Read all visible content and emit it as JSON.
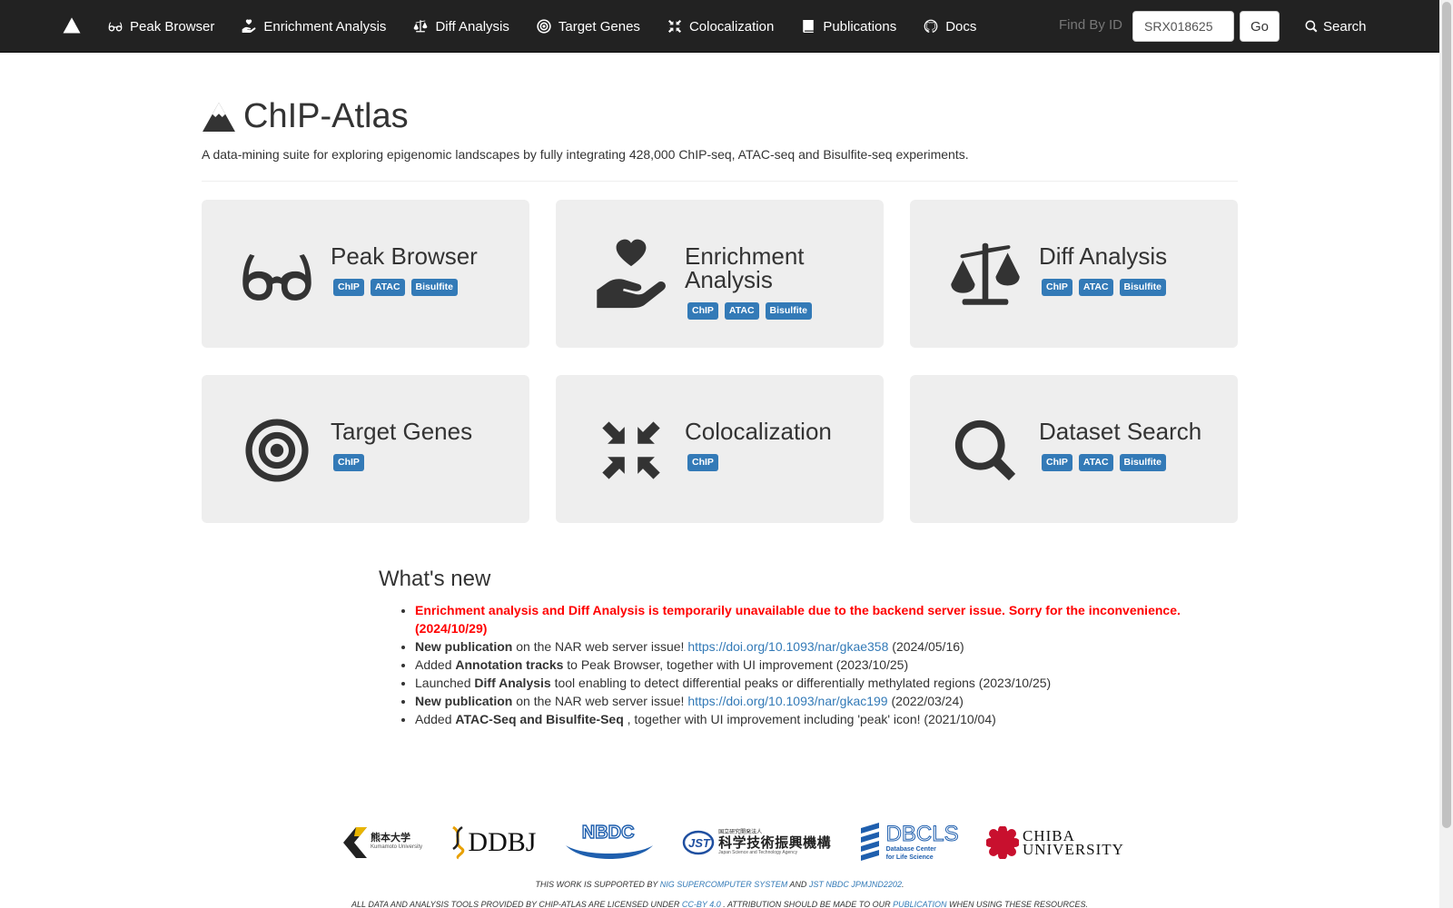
{
  "nav": {
    "brand_icon": "mountain-icon",
    "items": [
      {
        "label": "Peak Browser",
        "icon": "glasses-icon"
      },
      {
        "label": "Enrichment Analysis",
        "icon": "hand-holding-heart-icon"
      },
      {
        "label": "Diff Analysis",
        "icon": "scale-icon"
      },
      {
        "label": "Target Genes",
        "icon": "target-icon"
      },
      {
        "label": "Colocalization",
        "icon": "compress-icon"
      },
      {
        "label": "Publications",
        "icon": "book-icon"
      },
      {
        "label": "Docs",
        "icon": "github-icon"
      }
    ],
    "find_by_id_label": "Find By ID",
    "find_by_id_value": "SRX018625",
    "go_label": "Go",
    "search_label": "Search"
  },
  "header": {
    "title": "ChIP-Atlas",
    "subtitle": "A data-mining suite for exploring epigenomic landscapes by fully integrating 428,000 ChIP-seq, ATAC-seq and Bisulfite-seq experiments."
  },
  "cards": [
    {
      "title": "Peak Browser",
      "icon": "glasses-icon",
      "badges": [
        "ChIP",
        "ATAC",
        "Bisulfite"
      ]
    },
    {
      "title": "Enrichment Analysis",
      "icon": "hand-holding-heart-icon",
      "badges": [
        "ChIP",
        "ATAC",
        "Bisulfite"
      ]
    },
    {
      "title": "Diff Analysis",
      "icon": "scale-icon",
      "badges": [
        "ChIP",
        "ATAC",
        "Bisulfite"
      ]
    },
    {
      "title": "Target Genes",
      "icon": "target-icon",
      "badges": [
        "ChIP"
      ]
    },
    {
      "title": "Colocalization",
      "icon": "compress-icon",
      "badges": [
        "ChIP"
      ]
    },
    {
      "title": "Dataset Search",
      "icon": "search-icon",
      "badges": [
        "ChIP",
        "ATAC",
        "Bisulfite"
      ]
    }
  ],
  "whats_new": {
    "title": "What's new",
    "alert": "Enrichment analysis and Diff Analysis is temporarily unavailable due to the backend server issue. Sorry for the inconvenience. (2024/10/29)",
    "items": [
      {
        "bold": "New publication",
        "text": " on the NAR web server issue! ",
        "link": "https://doi.org/10.1093/nar/gkae358",
        "after": " (2024/05/16)"
      },
      {
        "pre": "Added ",
        "bold": "Annotation tracks",
        "text": " to Peak Browser, together with UI improvement (2023/10/25)"
      },
      {
        "pre": "Launched ",
        "bold": "Diff Analysis",
        "text": " tool enabling to detect differential peaks or differentially methylated regions (2023/10/25)"
      },
      {
        "bold": "New publication",
        "text": " on the NAR web server issue! ",
        "link": "https://doi.org/10.1093/nar/gkac199",
        "after": " (2022/03/24)"
      },
      {
        "pre": "Added ",
        "bold": "ATAC-Seq and Bisulfite-Seq",
        "text": " , together with UI improvement including 'peak' icon! (2021/10/04)"
      }
    ]
  },
  "footer": {
    "logos": {
      "kumamoto_jp": "熊本大学",
      "kumamoto_en": "Kumamoto University",
      "ddbj": "DDBJ",
      "nbdc": "NBDC",
      "jst": "JST",
      "jst_jp_small": "国立研究開発法人",
      "jst_jp": "科学技術振興機構",
      "jst_en": "Japan Science and Technology Agency",
      "dbcls": "DBCLS",
      "dbcls_sub1": "Database Center",
      "dbcls_sub2": "for Life Science",
      "chiba1": "CHIBA",
      "chiba2": "UNIVERSITY"
    },
    "line1_pre": "This work is supported by ",
    "line1_link1": "NIG supercomputer system",
    "line1_mid": " and ",
    "line1_link2": "JST NBDC JPMJND2202",
    "line1_post": ".",
    "line2_pre": "All data and analysis tools provided by ChIP-Atlas are licensed under ",
    "line2_link1": "CC-BY 4.0",
    "line2_mid": " . Attribution should be made to our ",
    "line2_link2": "publication",
    "line2_post": " when using these resources."
  }
}
